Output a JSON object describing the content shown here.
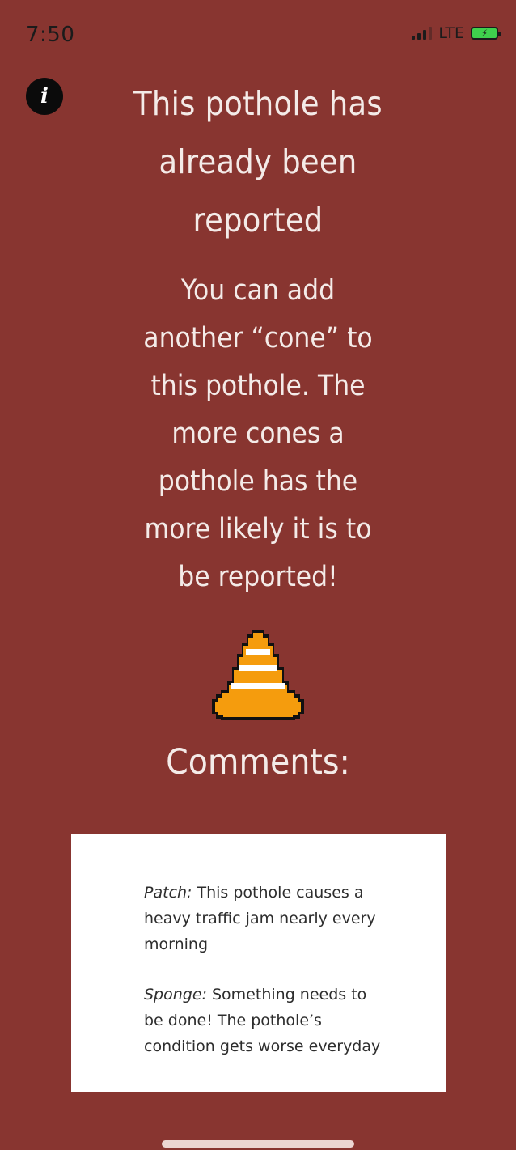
{
  "status_bar": {
    "time": "7:50",
    "network": "LTE"
  },
  "header": {
    "info_icon": "info-icon"
  },
  "title": "This pothole has already been reported",
  "message": "You can add another “cone” to this pothole. The more cones a pothole has the more likely it is to be reported!",
  "cone": {
    "icon": "traffic-cone-icon",
    "colors": {
      "orange": "#f59c0d",
      "stripe": "#ffffff",
      "outline": "#111111"
    }
  },
  "comments": {
    "heading": "Comments:",
    "items": [
      {
        "author": "Patch:",
        "text": " This pothole causes a heavy traffic jam nearly every morning"
      },
      {
        "author": "Sponge:",
        "text": " Something needs to be done! The pothole’s condition gets worse everyday"
      }
    ]
  },
  "colors": {
    "background": "#883530",
    "text": "#f4ebe8",
    "comment_box": "#ffffff"
  }
}
